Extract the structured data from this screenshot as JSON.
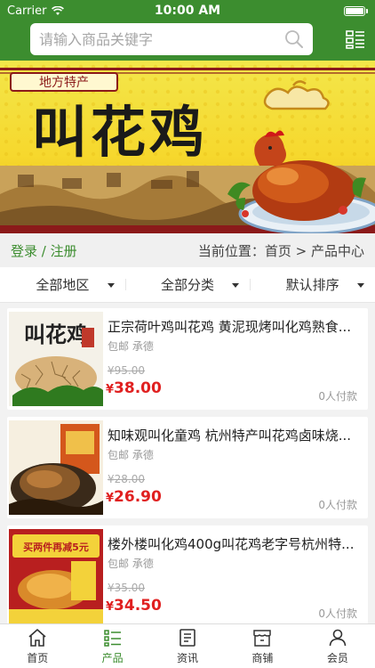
{
  "status": {
    "carrier": "Carrier",
    "time": "10:00 AM"
  },
  "search": {
    "placeholder": "请输入商品关键字"
  },
  "banner": {
    "badge": "地方特产",
    "title": "叫花鸡"
  },
  "crumb": {
    "login": "登录 / 注册",
    "location": "当前位置：首页 > 产品中心"
  },
  "filters": [
    {
      "label": "全部地区"
    },
    {
      "label": "全部分类"
    },
    {
      "label": "默认排序"
    }
  ],
  "products": [
    {
      "title": "正宗荷叶鸡叫花鸡 黄泥现烤叫化鸡熟食...",
      "tags": "包邮 承德",
      "old_price": "¥95.00",
      "price_symbol": "¥",
      "price": "38.00",
      "paid": "0人付款",
      "thumb_text": "叫花鸡"
    },
    {
      "title": "知味观叫化童鸡 杭州特产叫花鸡卤味烧...",
      "tags": "包邮 承德",
      "old_price": "¥28.00",
      "price_symbol": "¥",
      "price": "26.90",
      "paid": "0人付款",
      "thumb_text": ""
    },
    {
      "title": "楼外楼叫化鸡400g叫花鸡老字号杭州特...",
      "tags": "包邮 承德",
      "old_price": "¥35.00",
      "price_symbol": "¥",
      "price": "34.50",
      "paid": "0人付款",
      "thumb_text": "买两件再减5元"
    }
  ],
  "tabs": [
    {
      "label": "首页",
      "icon": "home-icon"
    },
    {
      "label": "产品",
      "icon": "list-icon"
    },
    {
      "label": "资讯",
      "icon": "news-icon"
    },
    {
      "label": "商铺",
      "icon": "store-icon"
    },
    {
      "label": "会员",
      "icon": "user-icon"
    }
  ],
  "colors": {
    "brand": "#3c8d2f",
    "price": "#e02020"
  }
}
